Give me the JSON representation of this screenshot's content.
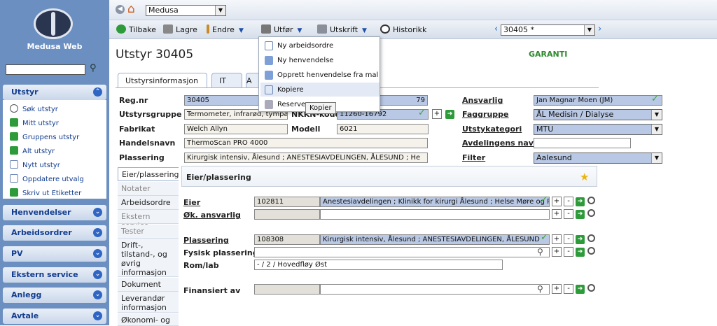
{
  "app": {
    "name": "Medusa Web",
    "selected_module": "Medusa"
  },
  "sidebar": {
    "search_placeholder": "",
    "sections": [
      {
        "label": "Utstyr",
        "expanded": true
      },
      {
        "label": "Henvendelser"
      },
      {
        "label": "Arbeidsordrer"
      },
      {
        "label": "PV"
      },
      {
        "label": "Ekstern service"
      },
      {
        "label": "Anlegg"
      },
      {
        "label": "Avtale"
      }
    ],
    "utstyr_items": [
      "Søk utstyr",
      "Mitt utstyr",
      "Gruppens utstyr",
      "Alt utstyr",
      "Nytt utstyr",
      "Oppdatere utvalg",
      "Skriv ut Etiketter"
    ]
  },
  "toolbar": {
    "back": "Tilbake",
    "save": "Lagre",
    "edit": "Endre",
    "perform": "Utfør",
    "print": "Utskrift",
    "history": "Historikk",
    "record_select": "30405 *"
  },
  "menu": {
    "items": [
      "Ny arbeidsordre",
      "Ny henvendelse",
      "Opprett henvendelse fra mal",
      "Kopiere",
      "Reserve"
    ],
    "tooltip": "Kopier"
  },
  "page": {
    "title": "Utstyr 30405",
    "status": "GARANTI",
    "tabs": [
      "Utstyrsinformasjon",
      "IT",
      "A"
    ]
  },
  "form": {
    "regnr_label": "Reg.nr",
    "regnr": "30405",
    "regnr_right": "79",
    "gruppe_label": "Utstyrsgruppe",
    "gruppe": "Termometer, infrarød, tympa",
    "nkkn_label": "NKKN-kode",
    "nkkn": "11260-16792",
    "fabrikat_label": "Fabrikat",
    "fabrikat": "Welch Allyn",
    "modell_label": "Modell",
    "modell": "6021",
    "handelsnavn_label": "Handelsnavn",
    "handelsnavn": "ThermoScan PRO 4000",
    "plassering_label": "Plassering",
    "plassering": "Kirurgisk intensiv,  Ålesund ; ANESTESIAVDELINGEN, ÅLESUND ; He",
    "ansvarlig_label": "Ansvarlig",
    "ansvarlig": "Jan Magnar Moen (JM)",
    "faggruppe_label": "Faggruppe",
    "faggruppe": "ÅL Medisin / Dialyse",
    "kategori_label": "Utstykategori",
    "kategori": "MTU",
    "avdnavn_label": "Avdelingens navn",
    "avdnavn": "",
    "filter_label": "Filter",
    "filter": "Aalesund"
  },
  "vtabs": [
    {
      "label": "Eier/plassering",
      "state": "active"
    },
    {
      "label": "Notater",
      "state": "disabled"
    },
    {
      "label": "Arbeidsordre",
      "state": "normal"
    },
    {
      "label": "Ekstern service",
      "state": "disabled"
    },
    {
      "label": "Tester",
      "state": "disabled"
    },
    {
      "label": "Drift-, tilstand-, og øvrig informasjon",
      "state": "normal"
    },
    {
      "label": "Dokument",
      "state": "normal"
    },
    {
      "label": "Leverandør informasjon",
      "state": "normal"
    },
    {
      "label": "Økonomi- og",
      "state": "normal"
    }
  ],
  "eier": {
    "header": "Eier/plassering",
    "eier_label": "Eier",
    "eier_code": "102811",
    "eier_text": "Anestesiavdelingen ; Klinikk for kirurgi Ålesund ; Helse Møre og R",
    "okansv_label": "Øk. ansvarlig",
    "plass_label": "Plassering",
    "plass_code": "108308",
    "plass_text": "Kirurgisk intensiv,  Ålesund ; ANESTESIAVDELINGEN, ÅLESUND",
    "fysisk_label": "Fysisk plassering",
    "romlab_label": "Rom/lab",
    "romlab": "- / 2 / Hovedfløy Øst",
    "fin_label": "Finansiert av"
  }
}
